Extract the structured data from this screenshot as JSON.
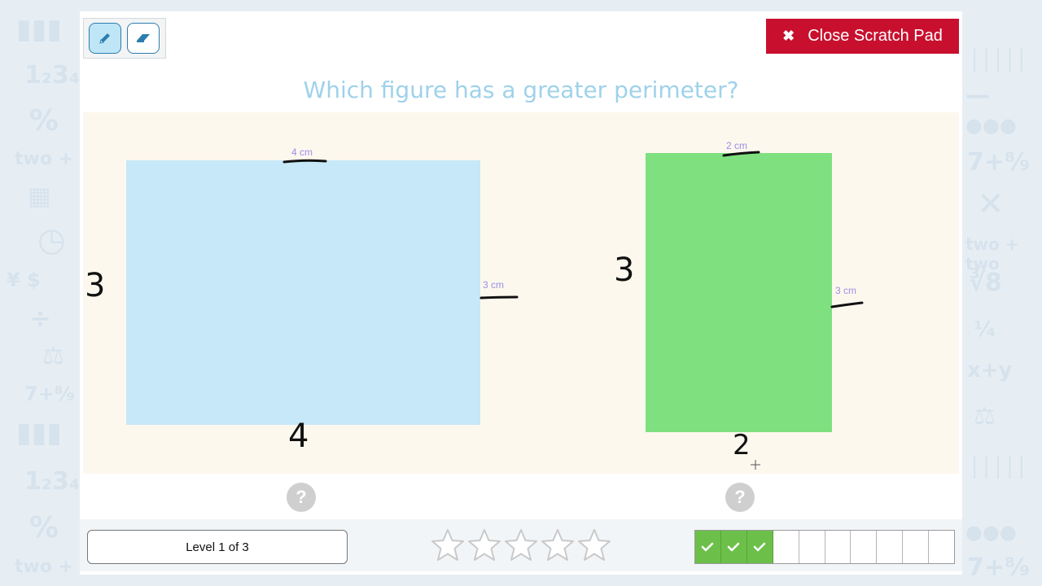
{
  "toolbar": {
    "pencil_icon": "pencil-icon",
    "eraser_icon": "eraser-icon"
  },
  "close_button": {
    "label": "Close Scratch Pad",
    "icon": "close-icon"
  },
  "question": "Which figure has a greater perimeter?",
  "figures": [
    {
      "name": "figure-a",
      "color": "#c6e8f9",
      "top_label": "4 cm",
      "side_label": "3 cm",
      "handwritten_left": "3",
      "handwritten_bottom": "4"
    },
    {
      "name": "figure-b",
      "color": "#7fe07f",
      "top_label": "2 cm",
      "side_label": "3 cm",
      "handwritten_left": "3",
      "handwritten_bottom": "2"
    }
  ],
  "help_buttons": [
    "?",
    "?"
  ],
  "footer": {
    "level": "Level 1 of 3",
    "stars_total": 5,
    "stars_filled": 0,
    "progress_total": 10,
    "progress_done": 3
  },
  "colors": {
    "accent_red": "#c8102e",
    "question_blue": "#9fd2ea",
    "progress_green": "#6cc04a"
  }
}
